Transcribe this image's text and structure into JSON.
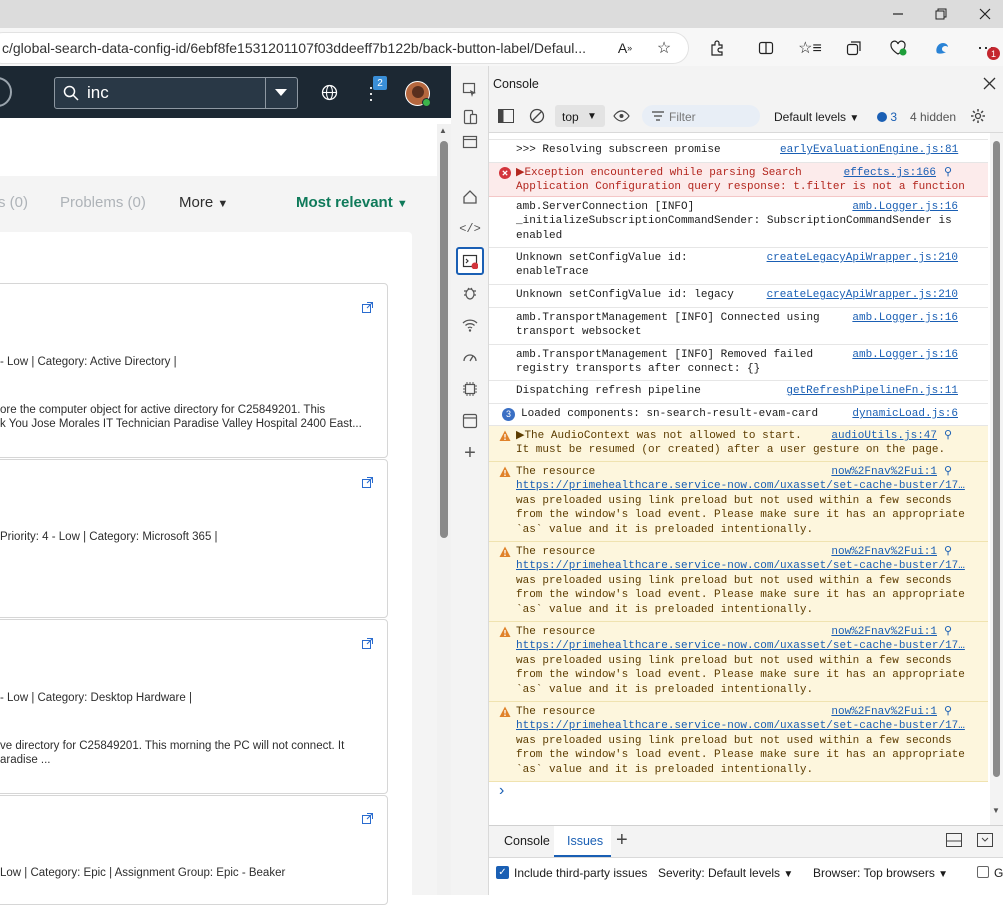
{
  "browser": {
    "url": "c/global-search-data-config-id/6ebf8fe1531201107f03ddeeff7b122b/back-button-label/Defaul..."
  },
  "page": {
    "search_value": "inc",
    "notification_count": "2",
    "tabs": [
      {
        "label": "s (0)"
      },
      {
        "label": "Problems (0)"
      },
      {
        "label": "More"
      },
      {
        "label": "Most relevant"
      }
    ],
    "cards": [
      {
        "line1": "- Low | Category: Active Directory |",
        "line2": "ore the computer object for active directory for C25849201. This",
        "line3": "k You Jose Morales IT Technician Paradise Valley Hospital 2400 East..."
      },
      {
        "line1": "Priority: 4 - Low | Category: Microsoft 365 |",
        "line2": "",
        "line3": ""
      },
      {
        "line1": "- Low | Category: Desktop Hardware |",
        "line2": "ve directory for C25849201. This morning the PC will not connect. It",
        "line3": "aradise ..."
      },
      {
        "line1": "Low | Category: Epic | Assignment Group: Epic - Beaker",
        "line2": "",
        "line3": ""
      }
    ]
  },
  "devtools": {
    "panel_title": "Console",
    "context": "top",
    "filter_placeholder": "Filter",
    "levels": "Default levels",
    "issues_count": "3",
    "hidden": "4 hidden",
    "messages": [
      {
        "text": ">>> Resolving subscreen promise",
        "src": "earlyEvaluationEngine.js:81"
      },
      {
        "text": "▶Exception encountered while parsing Search\nApplication Configuration query response: t.filter is not a function",
        "src": "effects.js:166"
      },
      {
        "text": "amb.ServerConnection [INFO]\n_initializeSubscriptionCommandSender: SubscriptionCommandSender is\nenabled",
        "src": "amb.Logger.js:16"
      },
      {
        "text": "Unknown setConfigValue id:\nenableTrace",
        "src": "createLegacyApiWrapper.js:210"
      },
      {
        "text": "Unknown setConfigValue id: legacy",
        "src": "createLegacyApiWrapper.js:210"
      },
      {
        "text": "amb.TransportManagement [INFO] Connected using\ntransport websocket",
        "src": "amb.Logger.js:16"
      },
      {
        "text": "amb.TransportManagement [INFO] Removed failed\nregistry transports after connect: {}",
        "src": "amb.Logger.js:16"
      },
      {
        "text": "Dispatching refresh pipeline",
        "src": "getRefreshPipelineFn.js:11"
      },
      {
        "text": "Loaded components: sn-search-result-evam-card",
        "src": "dynamicLoad.js:6",
        "count": "3"
      },
      {
        "text": "▶The AudioContext was not allowed to start.\nIt must be resumed (or created) after a user gesture on the page.",
        "src": "audioUtils.js:47"
      },
      {
        "pre": "The resource",
        "link": "https://primehealthcare.service-now.com/uxasset/set-cache-buster/17…",
        "post": "was preloaded using link preload but not used within a few seconds\nfrom the window's load event. Please make sure it has an appropriate\n`as` value and it is preloaded intentionally.",
        "src": "now%2Fnav%2Fui:1"
      },
      {
        "pre": "The resource",
        "link": "https://primehealthcare.service-now.com/uxasset/set-cache-buster/17…",
        "post": "was preloaded using link preload but not used within a few seconds\nfrom the window's load event. Please make sure it has an appropriate\n`as` value and it is preloaded intentionally.",
        "src": "now%2Fnav%2Fui:1"
      },
      {
        "pre": "The resource",
        "link": "https://primehealthcare.service-now.com/uxasset/set-cache-buster/17…",
        "post": "was preloaded using link preload but not used within a few seconds\nfrom the window's load event. Please make sure it has an appropriate\n`as` value and it is preloaded intentionally.",
        "src": "now%2Fnav%2Fui:1"
      },
      {
        "pre": "The resource",
        "link": "https://primehealthcare.service-now.com/uxasset/set-cache-buster/17…",
        "post": "was preloaded using link preload but not used within a few seconds\nfrom the window's load event. Please make sure it has an appropriate\n`as` value and it is preloaded intentionally.",
        "src": "now%2Fnav%2Fui:1"
      }
    ],
    "prompt": "›",
    "drawer_tabs": [
      "Console",
      "Issues"
    ],
    "issues_bar": {
      "include_third_party": "Include third-party issues",
      "severity": "Severity: Default levels",
      "browser": "Browser: Top browsers",
      "trailing": "G"
    }
  },
  "colors": {
    "nav_bg": "#1c2833",
    "accent_green": "#0f7a5a",
    "error_bg": "#fcebeb",
    "warn_bg": "#fdf6dd"
  }
}
